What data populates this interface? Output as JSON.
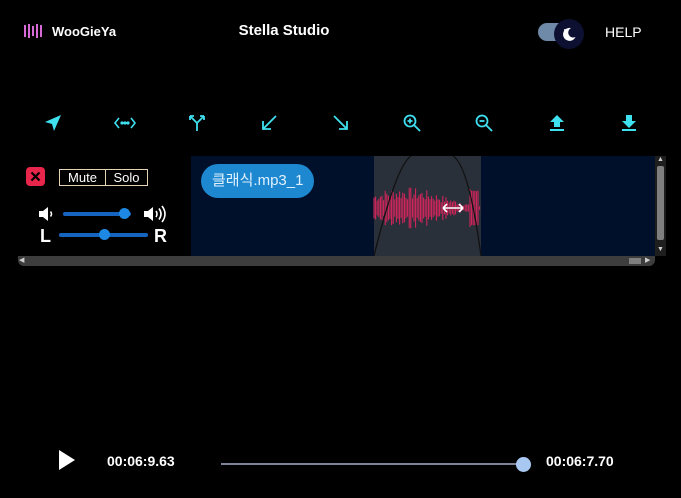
{
  "header": {
    "logo_text": "WooGieYa",
    "title": "Stella Studio",
    "help_label": "HELP",
    "theme": "dark"
  },
  "toolbar": {
    "tools": [
      {
        "name": "select-tool",
        "icon": "navigation-arrow-icon"
      },
      {
        "name": "stretch-tool",
        "icon": "horizontal-expand-icon"
      },
      {
        "name": "split-tool",
        "icon": "fork-icon"
      },
      {
        "name": "fade-in-tool",
        "icon": "arrow-down-left-icon"
      },
      {
        "name": "fade-out-tool",
        "icon": "arrow-down-right-icon"
      },
      {
        "name": "zoom-in-tool",
        "icon": "zoom-in-icon"
      },
      {
        "name": "zoom-out-tool",
        "icon": "zoom-out-icon"
      },
      {
        "name": "upload-tool",
        "icon": "upload-icon"
      },
      {
        "name": "download-tool",
        "icon": "download-icon"
      }
    ],
    "icon_color": "#3fe0f0"
  },
  "track": {
    "mute_label": "Mute",
    "solo_label": "Solo",
    "volume_level": 0.9,
    "pan_left_label": "L",
    "pan_right_label": "R",
    "pan_level": 0.5,
    "clip_name": "클래식.mp3_1",
    "waveform_color": "#e0245e"
  },
  "player": {
    "current_time": "00:06:9.63",
    "total_time": "00:06:7.70",
    "progress": 1.0
  },
  "colors": {
    "accent": "#1d88d0",
    "danger": "#e8254b",
    "logo": "#d66ad6"
  }
}
